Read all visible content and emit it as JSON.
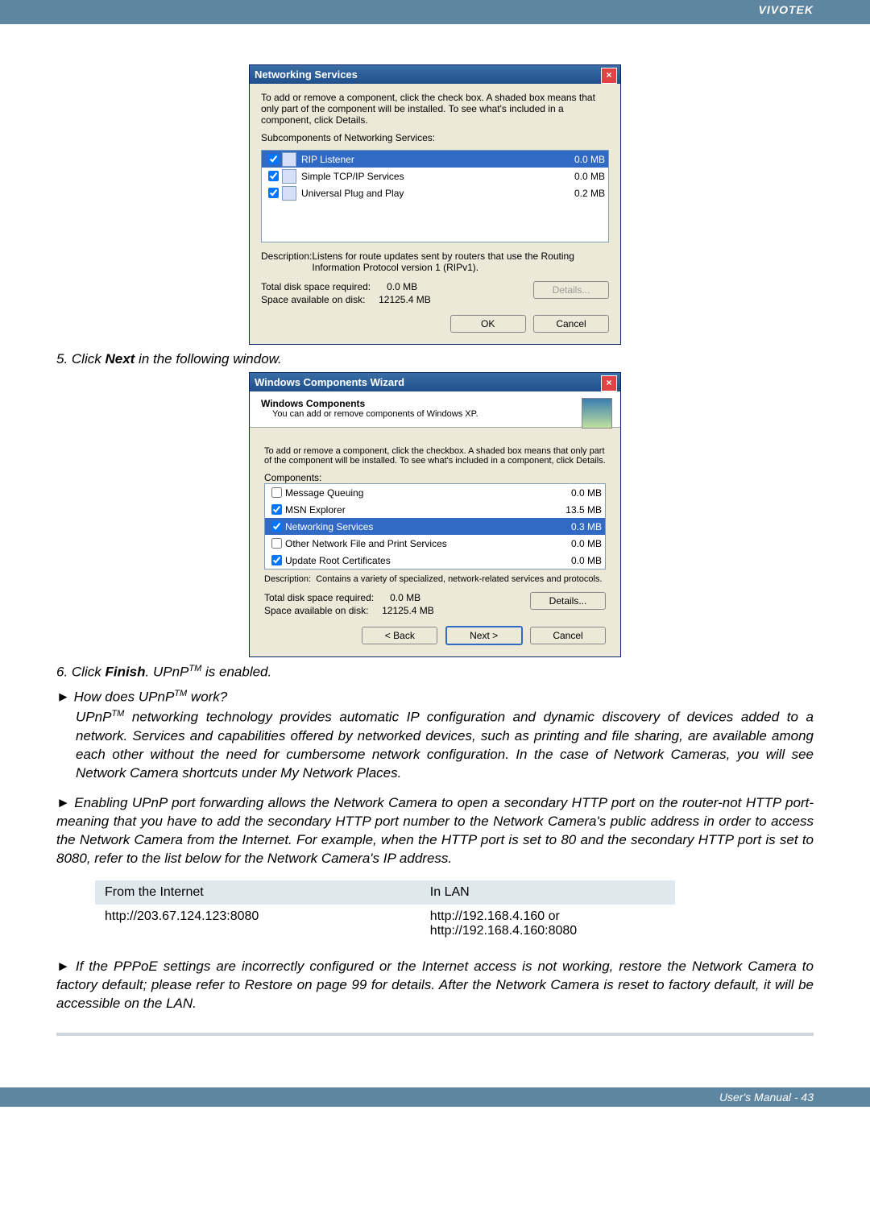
{
  "header": {
    "brand": "VIVOTEK"
  },
  "dialog1": {
    "title": "Networking Services",
    "intro": "To add or remove a component, click the check box. A shaded box means that only part of the component will be installed. To see what's included in a component, click Details.",
    "subcomponents_label": "Subcomponents of Networking Services:",
    "rows": [
      {
        "name": "RIP Listener",
        "size": "0.0 MB",
        "selected": true
      },
      {
        "name": "Simple TCP/IP Services",
        "size": "0.0 MB",
        "selected": false
      },
      {
        "name": "Universal Plug and Play",
        "size": "0.2 MB",
        "selected": false
      }
    ],
    "desc_label": "Description:",
    "desc_text": "Listens for route updates sent by routers that use the Routing Information Protocol version 1 (RIPv1).",
    "total_label": "Total disk space required:",
    "total_value": "0.0 MB",
    "avail_label": "Space available on disk:",
    "avail_value": "12125.4 MB",
    "details_btn": "Details...",
    "ok_btn": "OK",
    "cancel_btn": "Cancel"
  },
  "step5": {
    "pre": "5. Click ",
    "bold": "Next",
    "post": "  in the following window."
  },
  "wizard": {
    "title": "Windows Components Wizard",
    "head_strong": "Windows Components",
    "head_sub": "You can add or remove components of Windows XP.",
    "intro": "To add or remove a component, click the checkbox. A shaded box means that only part of the component will be installed. To see what's included in a component, click Details.",
    "components_label": "Components:",
    "rows": [
      {
        "name": "Message Queuing",
        "size": "0.0 MB",
        "checked": false,
        "selected": false
      },
      {
        "name": "MSN Explorer",
        "size": "13.5 MB",
        "checked": true,
        "selected": false
      },
      {
        "name": "Networking Services",
        "size": "0.3 MB",
        "checked": true,
        "selected": true
      },
      {
        "name": "Other Network File and Print Services",
        "size": "0.0 MB",
        "checked": false,
        "selected": false
      },
      {
        "name": "Update Root Certificates",
        "size": "0.0 MB",
        "checked": true,
        "selected": false
      }
    ],
    "desc_label": "Description:",
    "desc_text": "Contains a variety of specialized, network-related services and protocols.",
    "total_label": "Total disk space required:",
    "total_value": "0.0 MB",
    "avail_label": "Space available on disk:",
    "avail_value": "12125.4 MB",
    "details_btn": "Details...",
    "back_btn": "< Back",
    "next_btn": "Next >",
    "cancel_btn": "Cancel"
  },
  "step6": {
    "pre": "6. Click ",
    "bold": "Finish",
    "post": ". UPnP",
    "post2": " is enabled."
  },
  "q1": {
    "arrow": "►",
    "text_pre": "How does UPnP",
    "text_post": " work?"
  },
  "q1_body": {
    "pre": "UPnP",
    "body": " networking technology provides automatic IP configuration and dynamic discovery of devices added to a network. Services and capabilities offered by networked devices, such as printing and file sharing, are available among each other without the need for cumbersome network configuration. In the case of Network Cameras, you will see Network Camera shortcuts under My Network Places."
  },
  "q2": {
    "arrow": "►",
    "body": "Enabling UPnP port forwarding allows the Network Camera to open a secondary HTTP port on the router-not HTTP port-meaning that you have to add the secondary HTTP port number to the Network Camera's public address in order to access the Network Camera from the Internet. For example, when the HTTP port is set to 80 and the secondary HTTP port is set to 8080, refer to the list below for the Network Camera's IP address."
  },
  "table": {
    "col1": "From the Internet",
    "col2": "In LAN",
    "cell1": "http://203.67.124.123:8080",
    "cell2a": "http://192.168.4.160 or",
    "cell2b": "http://192.168.4.160:8080"
  },
  "q3": {
    "arrow": "►",
    "body": "If the PPPoE settings are incorrectly configured or the Internet access is not working, restore the Network Camera to factory default; please refer to Restore on page 99 for details. After the Network Camera is reset to factory default, it will be accessible on the LAN."
  },
  "footer": {
    "text": "User's Manual - 43"
  }
}
